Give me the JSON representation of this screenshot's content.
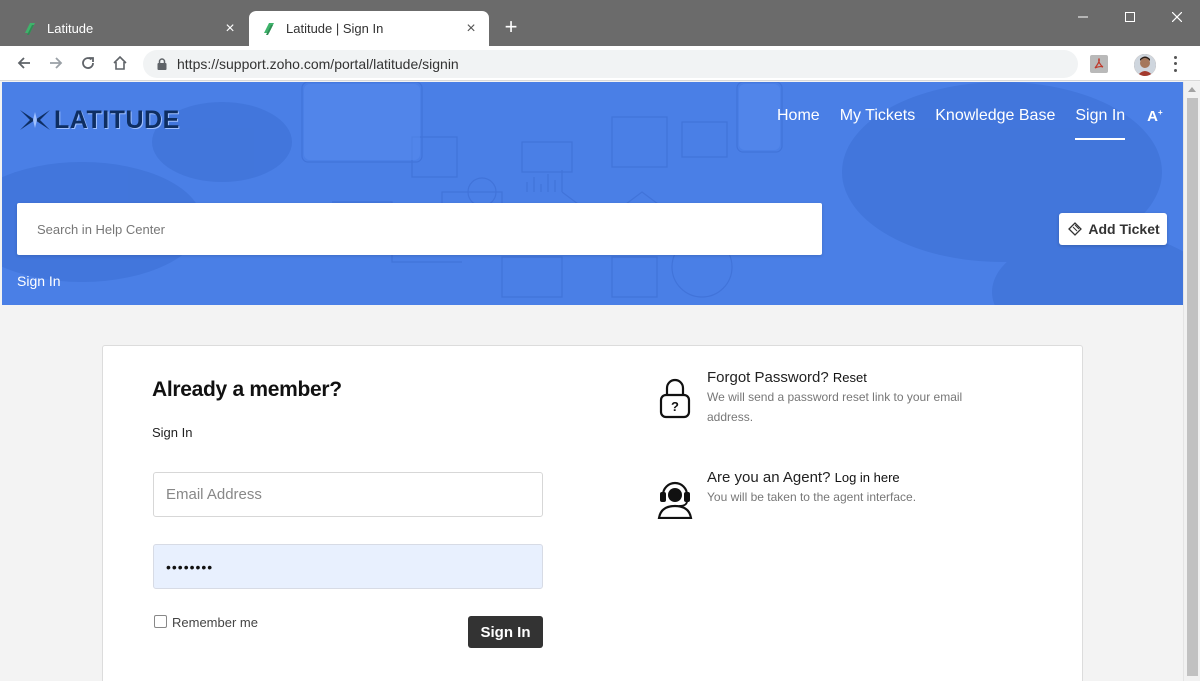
{
  "browser": {
    "tabs": [
      {
        "title": "Latitude",
        "active": false,
        "close": "×"
      },
      {
        "title": "Latitude | Sign In",
        "active": true,
        "close": "×"
      }
    ],
    "new_tab": "+",
    "url": "https://support.zoho.com/portal/latitude/signin",
    "icons": [
      "back-icon",
      "forward-icon",
      "reload-icon",
      "home-icon",
      "lock-icon",
      "pdf-extension-icon",
      "profile-avatar",
      "menu-dots-icon",
      "minimize-icon",
      "maximize-icon",
      "close-icon"
    ],
    "colors": {
      "tabstrip": "#6b6b6b",
      "active_tab": "#ffffff"
    }
  },
  "site": {
    "logo_text": "LATITUDE",
    "nav": [
      {
        "label": "Home",
        "active": false
      },
      {
        "label": "My Tickets",
        "active": false
      },
      {
        "label": "Knowledge Base",
        "active": false
      },
      {
        "label": "Sign In",
        "active": true
      }
    ],
    "font_size_toggle": "A",
    "search_placeholder": "Search in Help Center",
    "add_ticket_label": "Add Ticket",
    "breadcrumb": "Sign In",
    "colors": {
      "hero": "#4a7fe6",
      "button_dark": "#333333"
    }
  },
  "signin": {
    "heading": "Already a member?",
    "subheading": "Sign In",
    "email_placeholder": "Email Address",
    "password_value": "••••••••",
    "remember_label": "Remember me",
    "remember_checked": false,
    "submit_label": "Sign In"
  },
  "side": {
    "forgot_title": "Forgot Password?",
    "forgot_link": "Reset",
    "forgot_desc": "We will send a password reset link to your email address.",
    "agent_title": "Are you an Agent?",
    "agent_link": "Log in here",
    "agent_desc": "You will be taken to the agent interface."
  }
}
